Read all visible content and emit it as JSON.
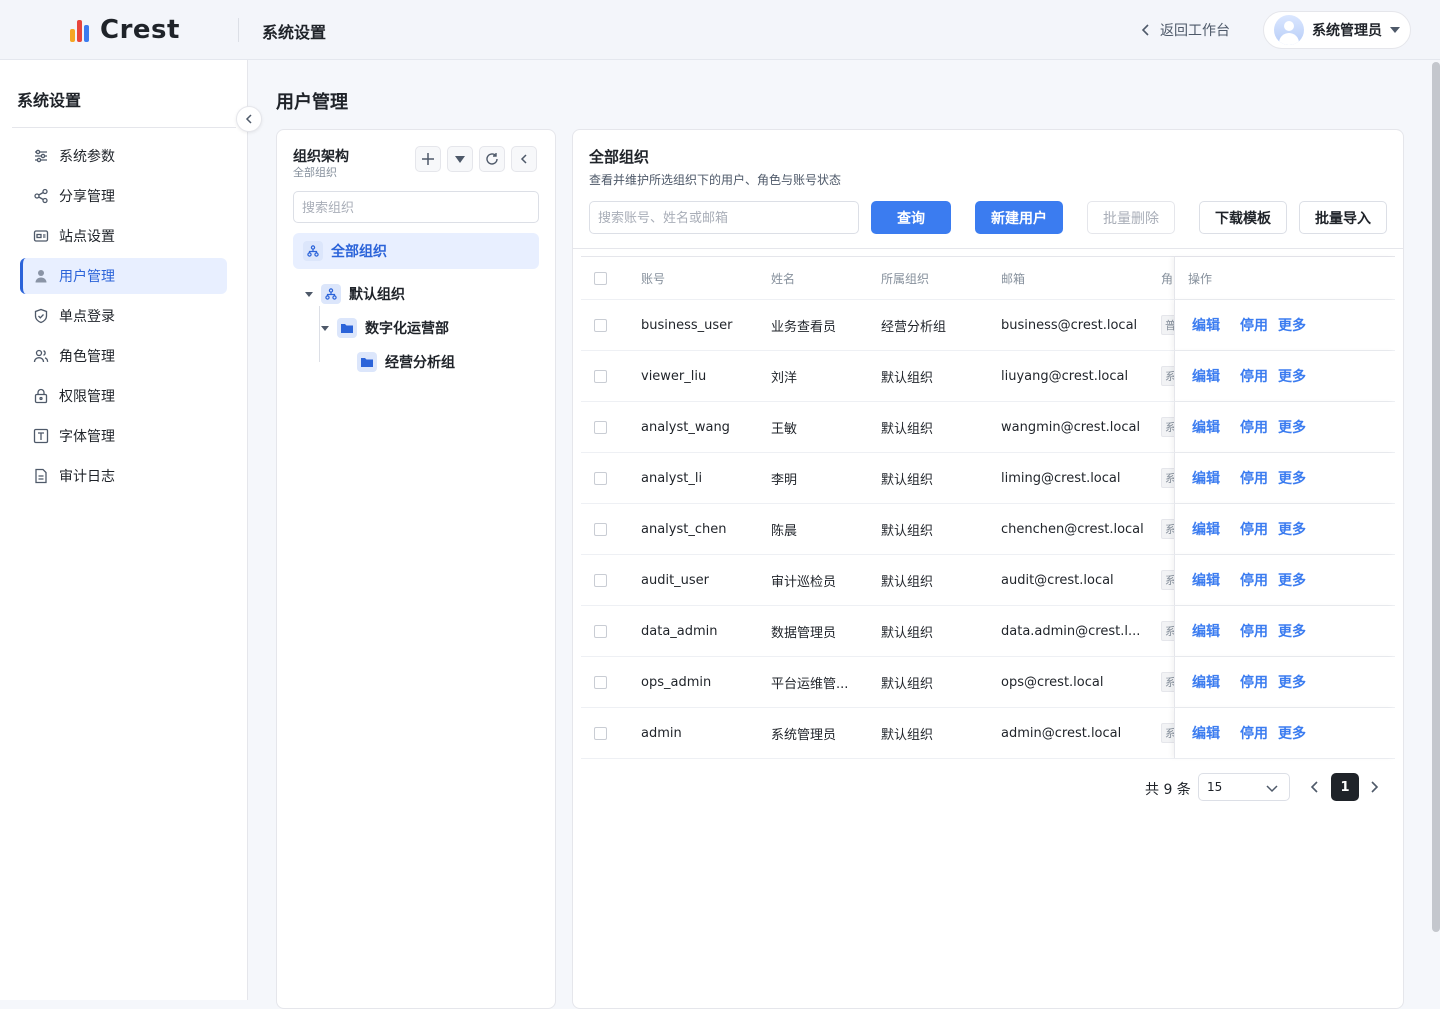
{
  "header": {
    "logo_text": "Crest",
    "title": "系统设置",
    "back_label": "返回工作台",
    "user_name": "系统管理员",
    "logo_colors": [
      "#f5a623",
      "#e8453c",
      "#3b7cf0"
    ]
  },
  "sidebar": {
    "title": "系统设置",
    "items": [
      {
        "label": "系统参数",
        "icon": "sliders-icon"
      },
      {
        "label": "分享管理",
        "icon": "share-icon"
      },
      {
        "label": "站点设置",
        "icon": "site-card-icon"
      },
      {
        "label": "用户管理",
        "icon": "user-icon",
        "active": true
      },
      {
        "label": "单点登录",
        "icon": "shield-check-icon"
      },
      {
        "label": "角色管理",
        "icon": "users-icon"
      },
      {
        "label": "权限管理",
        "icon": "lock-icon"
      },
      {
        "label": "字体管理",
        "icon": "font-icon"
      },
      {
        "label": "审计日志",
        "icon": "document-icon"
      }
    ]
  },
  "main": {
    "title": "用户管理"
  },
  "org_panel": {
    "title": "组织架构",
    "subtitle": "全部组织",
    "search_placeholder": "搜索组织",
    "all_label": "全部组织",
    "tree": [
      {
        "label": "默认组织"
      },
      {
        "label": "数字化运营部"
      },
      {
        "label": "经营分析组"
      }
    ]
  },
  "content": {
    "title": "全部组织",
    "subtitle": "查看并维护所选组织下的用户、角色与账号状态",
    "search_placeholder": "搜索账号、姓名或邮箱",
    "buttons": {
      "query": "查询",
      "new_user": "新建用户",
      "batch_delete": "批量删除",
      "download_template": "下载模板",
      "batch_import": "批量导入"
    },
    "columns": {
      "account": "账号",
      "name": "姓名",
      "org": "所属组织",
      "email": "邮箱",
      "role": "角色",
      "actions": "操作"
    },
    "row_actions": {
      "edit": "编辑",
      "disable": "停用",
      "more": "更多"
    },
    "rows": [
      {
        "account": "business_user",
        "name": "业务查看员",
        "org": "经营分析组",
        "email": "business@crest.local",
        "role": "普"
      },
      {
        "account": "viewer_liu",
        "name": "刘洋",
        "org": "默认组织",
        "email": "liuyang@crest.local",
        "role": "系"
      },
      {
        "account": "analyst_wang",
        "name": "王敏",
        "org": "默认组织",
        "email": "wangmin@crest.local",
        "role": "系"
      },
      {
        "account": "analyst_li",
        "name": "李明",
        "org": "默认组织",
        "email": "liming@crest.local",
        "role": "系"
      },
      {
        "account": "analyst_chen",
        "name": "陈晨",
        "org": "默认组织",
        "email": "chenchen@crest.local",
        "role": "系"
      },
      {
        "account": "audit_user",
        "name": "审计巡检员",
        "org": "默认组织",
        "email": "audit@crest.local",
        "role": "系"
      },
      {
        "account": "data_admin",
        "name": "数据管理员",
        "org": "默认组织",
        "email": "data.admin@crest.l...",
        "role": "系"
      },
      {
        "account": "ops_admin",
        "name": "平台运维管...",
        "org": "默认组织",
        "email": "ops@crest.local",
        "role": "系"
      },
      {
        "account": "admin",
        "name": "系统管理员",
        "org": "默认组织",
        "email": "admin@crest.local",
        "role": "系"
      }
    ],
    "pagination": {
      "total": "共 9 条",
      "page_size": "15",
      "current_page": "1"
    }
  },
  "colors": {
    "primary": "#3b7cf0",
    "active_bg": "#e8efff",
    "active_text": "#2b63d9"
  }
}
